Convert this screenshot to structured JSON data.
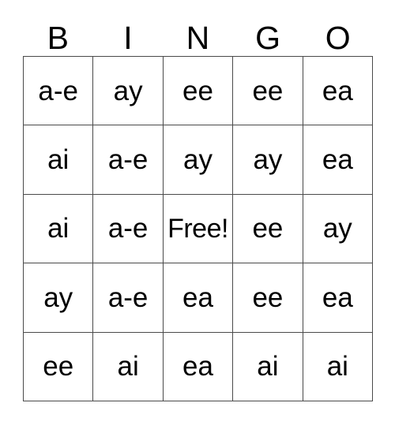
{
  "card": {
    "title": "BINGO",
    "header_letters": [
      "B",
      "I",
      "N",
      "G",
      "O"
    ],
    "free_space_label": "Free!",
    "colors": {
      "background": "#ffffff",
      "grid_line": "#4a4a4a",
      "text": "#000000"
    },
    "grid": {
      "columns": 5,
      "rows": 5,
      "cells": [
        [
          {
            "label": "a-e"
          },
          {
            "label": "ay"
          },
          {
            "label": "ee"
          },
          {
            "label": "ee"
          },
          {
            "label": "ea"
          }
        ],
        [
          {
            "label": "ai"
          },
          {
            "label": "a-e"
          },
          {
            "label": "ay"
          },
          {
            "label": "ay"
          },
          {
            "label": "ea"
          }
        ],
        [
          {
            "label": "ai"
          },
          {
            "label": "a-e"
          },
          {
            "label": "Free!"
          },
          {
            "label": "ee"
          },
          {
            "label": "ay"
          }
        ],
        [
          {
            "label": "ay"
          },
          {
            "label": "a-e"
          },
          {
            "label": "ea"
          },
          {
            "label": "ee"
          },
          {
            "label": "ea"
          }
        ],
        [
          {
            "label": "ee"
          },
          {
            "label": "ai"
          },
          {
            "label": "ea"
          },
          {
            "label": "ai"
          },
          {
            "label": "ai"
          }
        ]
      ]
    }
  }
}
